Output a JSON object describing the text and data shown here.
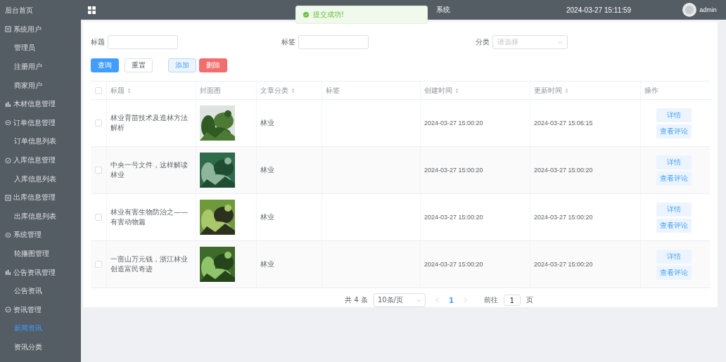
{
  "sidebar": {
    "items": [
      {
        "label": "后台首页",
        "selected": false
      },
      {
        "label": "系统用户",
        "selected": false,
        "children": [
          {
            "label": "管理员",
            "selected": false
          },
          {
            "label": "注册用户",
            "selected": false
          },
          {
            "label": "商家用户",
            "selected": false
          }
        ]
      },
      {
        "label": "木材信息管理",
        "selected": false
      },
      {
        "label": "订单信息管理",
        "selected": false,
        "children": [
          {
            "label": "订单信息列表",
            "selected": false
          }
        ]
      },
      {
        "label": "入库信息管理",
        "selected": false,
        "children": [
          {
            "label": "入库信息列表",
            "selected": false
          }
        ]
      },
      {
        "label": "出库信息管理",
        "selected": false,
        "children": [
          {
            "label": "出库信息列表",
            "selected": false
          }
        ]
      },
      {
        "label": "系统管理",
        "selected": false,
        "children": [
          {
            "label": "轮播图管理",
            "selected": false
          }
        ]
      },
      {
        "label": "公告资讯管理",
        "selected": false,
        "children": [
          {
            "label": "公告资讯",
            "selected": false
          }
        ]
      },
      {
        "label": "资讯管理",
        "selected": false,
        "children": [
          {
            "label": "新闻资讯",
            "selected": true
          },
          {
            "label": "资讯分类",
            "selected": false
          }
        ]
      }
    ]
  },
  "header": {
    "title": "系统",
    "datetime": "2024-03-27 15:11:59",
    "user": "admin"
  },
  "toast": {
    "message": "提交成功!"
  },
  "filters": [
    {
      "label": "标题",
      "kind": "input"
    },
    {
      "label": "标签",
      "kind": "input"
    },
    {
      "label": "分类",
      "kind": "select",
      "placeholder": "请选择"
    }
  ],
  "buttons": [
    {
      "label": "查询",
      "kind": "primary"
    },
    {
      "label": "重置",
      "kind": "default"
    },
    {
      "label": "添加",
      "kind": "plain"
    },
    {
      "label": "删除",
      "kind": "danger"
    }
  ],
  "table": {
    "select_all": {
      "checked": false
    },
    "columns": [
      {
        "label": "标题",
        "sortable": true
      },
      {
        "label": "封面图",
        "sortable": false
      },
      {
        "label": "文章分类",
        "sortable": true
      },
      {
        "label": "标签",
        "sortable": false
      },
      {
        "label": "创建时间",
        "sortable": true
      },
      {
        "label": "更新时间",
        "sortable": true
      },
      {
        "label": "操作",
        "sortable": false
      }
    ],
    "rows": [
      {
        "checked": false,
        "title": "林业育苗技术及造林方法解析",
        "category": "林业",
        "created": "2024-03-27 15:00:20",
        "updated": "2024-03-27 15:06:15",
        "actions": [
          "详情",
          "查看评论"
        ]
      },
      {
        "checked": false,
        "title": "中央一号文件，这样解读林业",
        "category": "林业",
        "created": "2024-03-27 15:00:20",
        "updated": "2024-03-27 15:00:20",
        "actions": [
          "详情",
          "查看评论"
        ]
      },
      {
        "checked": false,
        "title": "林业有害生物防治之——有害动物篇",
        "category": "林业",
        "created": "2024-03-27 15:00:20",
        "updated": "2024-03-27 15:00:20",
        "actions": [
          "详情",
          "查看评论"
        ]
      },
      {
        "checked": false,
        "title": "一亩山万元钱，浙江林业创造富民奇迹",
        "category": "林业",
        "created": "2024-03-27 15:00:20",
        "updated": "2024-03-27 15:00:20",
        "actions": [
          "详情",
          "查看评论"
        ]
      }
    ]
  },
  "pagination": {
    "total": "共 4 条",
    "page_size": "10条/页",
    "pages": [
      {
        "label": "1",
        "selected": true
      }
    ],
    "goto_label": "前往",
    "goto_value": "1",
    "goto_suffix": "页"
  }
}
